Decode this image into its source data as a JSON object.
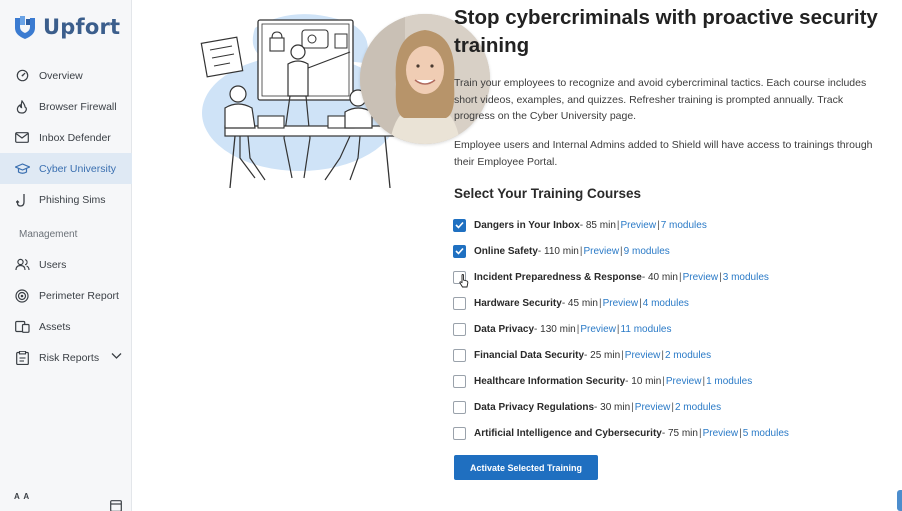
{
  "app": {
    "brand": "Upfort",
    "accent": "#1f70c1"
  },
  "sidebar": {
    "items": [
      {
        "label": "Overview",
        "icon": "gauge-icon"
      },
      {
        "label": "Browser Firewall",
        "icon": "flame-icon"
      },
      {
        "label": "Inbox Defender",
        "icon": "mail-icon"
      },
      {
        "label": "Cyber University",
        "icon": "graduation-cap-icon",
        "active": true
      },
      {
        "label": "Phishing Sims",
        "icon": "hook-icon"
      }
    ],
    "section_label": "Management",
    "management_items": [
      {
        "label": "Users",
        "icon": "users-icon"
      },
      {
        "label": "Perimeter Report",
        "icon": "target-icon"
      },
      {
        "label": "Assets",
        "icon": "devices-icon"
      },
      {
        "label": "Risk Reports",
        "icon": "report-icon"
      }
    ],
    "text_size_label": "A A"
  },
  "main": {
    "title": "Stop cybercriminals with proactive security training",
    "para1": "Train your employees to recognize and avoid cybercriminal tactics. Each course includes short videos, examples, and quizzes. Refresher training is prompted annually. Track progress on the Cyber University page.",
    "para2": "Employee users and Internal Admins added to Shield will have access to trainings through their Employee Portal.",
    "section_title": "Select Your Training Courses",
    "preview_label": "Preview",
    "courses": [
      {
        "name": "Dangers in Your Inbox",
        "duration": " - 85 min",
        "modules": "7 modules",
        "checked": true
      },
      {
        "name": "Online Safety",
        "duration": " - 110 min",
        "modules": "9 modules",
        "checked": true
      },
      {
        "name": "Incident Preparedness & Response",
        "duration": " - 40 min",
        "modules": "3 modules",
        "checked": false
      },
      {
        "name": "Hardware Security",
        "duration": " - 45 min",
        "modules": "4 modules",
        "checked": false
      },
      {
        "name": "Data Privacy",
        "duration": " - 130 min",
        "modules": "11 modules",
        "checked": false
      },
      {
        "name": "Financial Data Security",
        "duration": " - 25 min",
        "modules": "2 modules",
        "checked": false
      },
      {
        "name": "Healthcare Information Security",
        "duration": " - 10 min",
        "modules": "1 modules",
        "checked": false
      },
      {
        "name": "Data Privacy Regulations",
        "duration": " - 30 min",
        "modules": "2 modules",
        "checked": false
      },
      {
        "name": "Artificial Intelligence and Cybersecurity",
        "duration": " - 75 min",
        "modules": "5 modules",
        "checked": false
      }
    ],
    "activate_label": "Activate Selected Training"
  }
}
